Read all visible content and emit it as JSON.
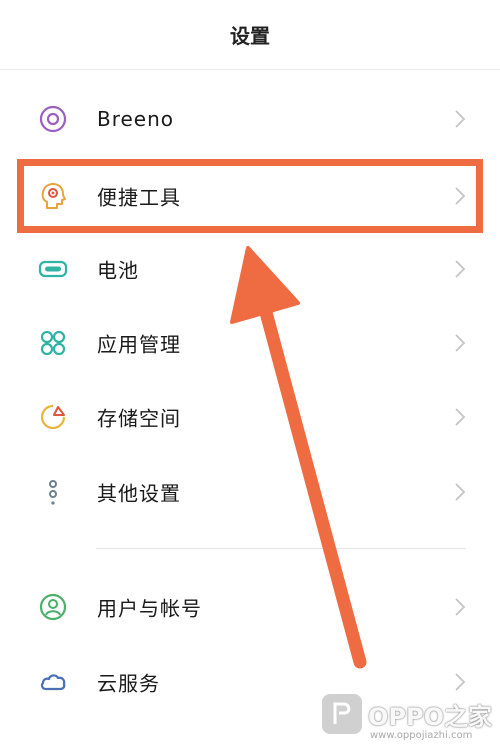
{
  "header": {
    "title": "设置"
  },
  "settings": {
    "items": [
      {
        "label": "Breeno",
        "icon": "breeno-icon",
        "color": "#9b5fc0"
      },
      {
        "label": "便捷工具",
        "icon": "convenience-tools-icon",
        "color": "#e8a33a"
      },
      {
        "label": "电池",
        "icon": "battery-icon",
        "color": "#2fb3a3"
      },
      {
        "label": "应用管理",
        "icon": "app-management-icon",
        "color": "#2fb3a3"
      },
      {
        "label": "存储空间",
        "icon": "storage-icon",
        "color": "#e8b43a"
      },
      {
        "label": "其他设置",
        "icon": "other-settings-icon",
        "color": "#6b7f95"
      },
      {
        "label": "用户与帐号",
        "icon": "user-account-icon",
        "color": "#4caf6a"
      },
      {
        "label": "云服务",
        "icon": "cloud-service-icon",
        "color": "#4a6fb5"
      }
    ]
  },
  "annotation": {
    "color": "#ef6b41"
  },
  "watermark": {
    "text": "OPPO之家",
    "url": "www.oppojiazhi.com"
  }
}
